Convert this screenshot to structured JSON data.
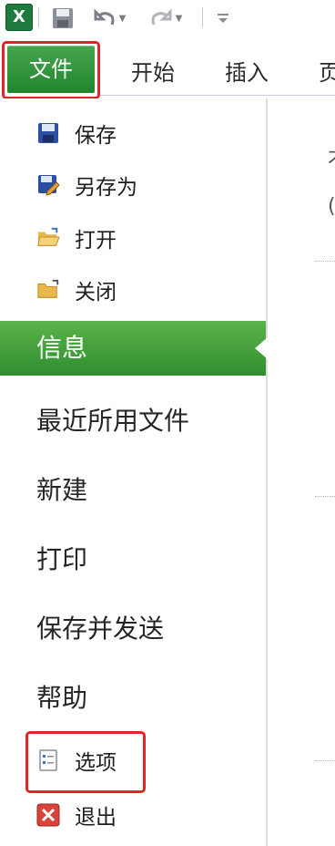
{
  "app": {
    "logo_label": "X"
  },
  "quick_access": {
    "save_icon": "save-icon",
    "undo_icon": "undo-icon",
    "redo_icon": "redo-icon",
    "customize_icon": "customize-icon"
  },
  "ribbon": {
    "file_tab": "文件",
    "tabs": [
      "开始",
      "插入",
      "页"
    ]
  },
  "backstage": {
    "commands": [
      {
        "label": "保存",
        "icon": "save-icon"
      },
      {
        "label": "另存为",
        "icon": "save-as-icon"
      },
      {
        "label": "打开",
        "icon": "open-folder-icon"
      },
      {
        "label": "关闭",
        "icon": "close-folder-icon"
      }
    ],
    "nav": [
      {
        "label": "信息",
        "selected": true
      },
      {
        "label": "最近所用文件",
        "selected": false
      },
      {
        "label": "新建",
        "selected": false
      },
      {
        "label": "打印",
        "selected": false
      },
      {
        "label": "保存并发送",
        "selected": false
      },
      {
        "label": "帮助",
        "selected": false
      }
    ],
    "options": {
      "label": "选项",
      "icon": "options-icon"
    },
    "exit": {
      "label": "退出",
      "icon": "exit-icon"
    }
  },
  "right_panel": {
    "peek_text_1": "才",
    "peek_text_2": "("
  },
  "colors": {
    "accent_green": "#2f8e2f",
    "highlight_red": "#e02525"
  }
}
